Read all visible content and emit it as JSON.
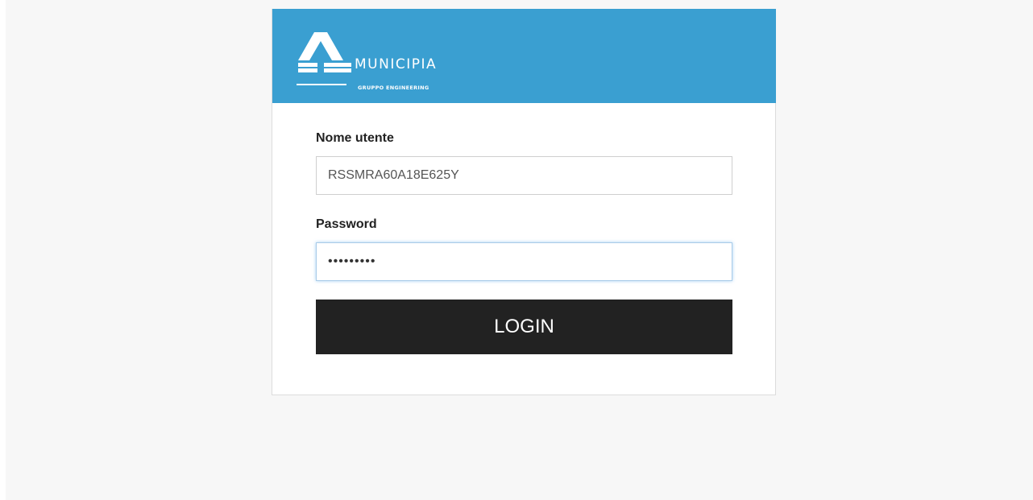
{
  "brand": {
    "name": "MUNICIPIA",
    "subtitle": "GRUPPO ENGINEERING",
    "logo_icon": "municipia-logo-icon",
    "header_color": "#3a9fd1"
  },
  "form": {
    "username_label": "Nome utente",
    "username_value": "RSSMRA60A18E625Y",
    "password_label": "Password",
    "password_value": "•••••••••",
    "login_label": "LOGIN",
    "button_color": "#222222"
  }
}
